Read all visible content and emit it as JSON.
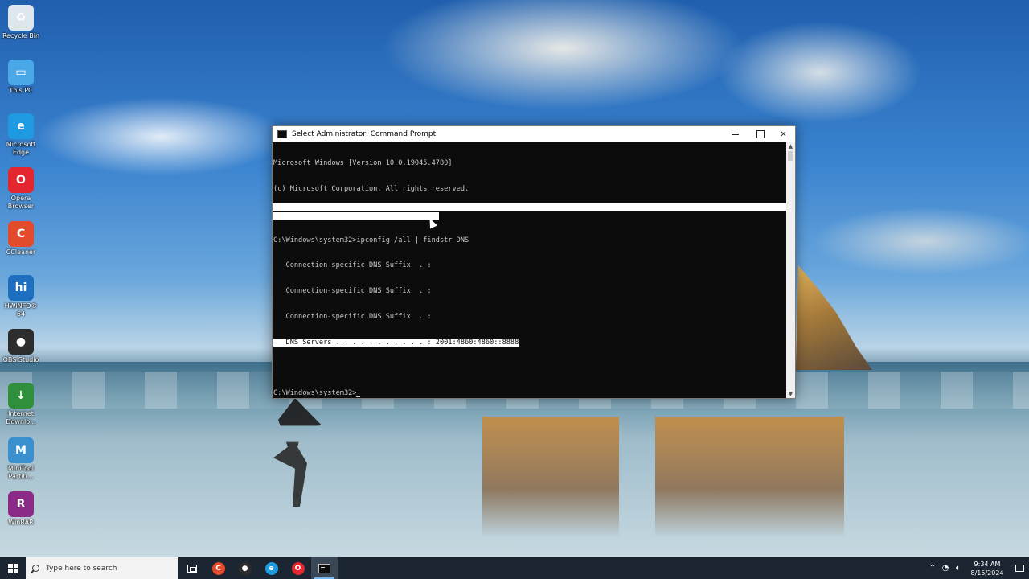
{
  "desktop": {
    "icons": [
      {
        "name": "recycle-bin",
        "label": "Recycle Bin",
        "glyph": "♻",
        "color": "#dfe7ee"
      },
      {
        "name": "this-pc",
        "label": "This PC",
        "glyph": "▭",
        "color": "#4aa8e8"
      },
      {
        "name": "microsoft-edge",
        "label": "Microsoft Edge",
        "glyph": "e",
        "color": "#1e9be0"
      },
      {
        "name": "opera-browser",
        "label": "Opera Browser",
        "glyph": "O",
        "color": "#e4262f"
      },
      {
        "name": "ccleaner",
        "label": "CCleaner",
        "glyph": "C",
        "color": "#e44b2c"
      },
      {
        "name": "hwinfo64",
        "label": "HWiNFO® 64",
        "glyph": "hi",
        "color": "#1f6fc1"
      },
      {
        "name": "obs-studio",
        "label": "OBS Studio",
        "glyph": "●",
        "color": "#2d2d2d"
      },
      {
        "name": "internet-download-manager",
        "label": "Internet Downlo...",
        "glyph": "↓",
        "color": "#2f8f3a"
      },
      {
        "name": "minitool-partition",
        "label": "MiniTool Partiti...",
        "glyph": "M",
        "color": "#3a8fcf"
      },
      {
        "name": "winrar",
        "label": "WinRAR",
        "glyph": "R",
        "color": "#8c2a88"
      }
    ]
  },
  "cmd": {
    "title": "Select Administrator: Command Prompt",
    "lines": [
      "Microsoft Windows [Version 10.0.19045.4780]",
      "(c) Microsoft Corporation. All rights reserved.",
      "",
      "C:\\Windows\\system32>ipconfig /all | findstr DNS",
      "   Connection-specific DNS Suffix  . :",
      "   Connection-specific DNS Suffix  . :",
      "   Connection-specific DNS Suffix  . :"
    ],
    "dns_line_label": "   DNS Servers . . . . . . . . . . . : ",
    "dns_line_value": "2001:4860:4860::8888",
    "prompt_line": "C:\\Windows\\system32>"
  },
  "taskbar": {
    "search_placeholder": "Type here to search",
    "pinned": [
      {
        "name": "ccleaner",
        "glyph": "C",
        "color": "#e44b2c"
      },
      {
        "name": "obs-studio",
        "glyph": "●",
        "color": "#2d2d2d"
      },
      {
        "name": "microsoft-edge",
        "glyph": "e",
        "color": "#1e9be0"
      },
      {
        "name": "opera-browser",
        "glyph": "O",
        "color": "#e4262f"
      }
    ],
    "time": "9:34 AM",
    "date": "8/15/2024"
  }
}
